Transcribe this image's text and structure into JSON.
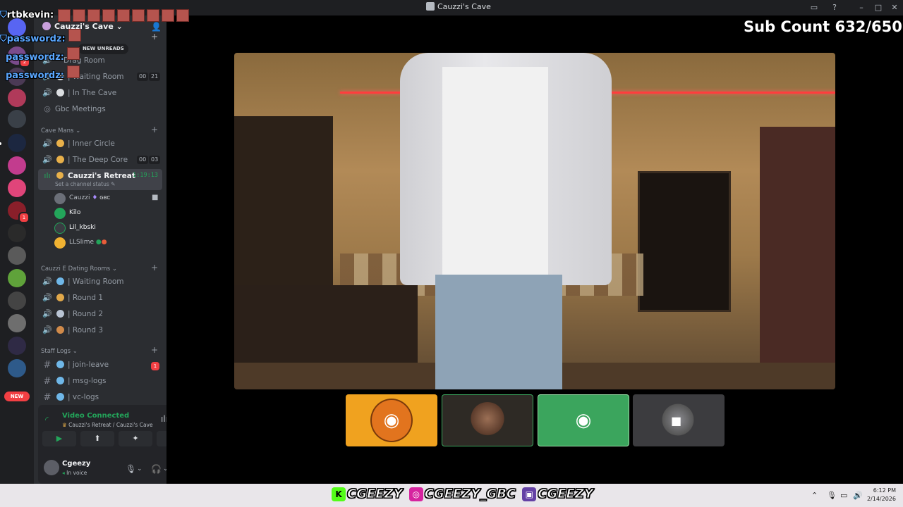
{
  "window": {
    "title": "Cauzzi's Cave"
  },
  "stream_overlay": {
    "sub_count": "Sub Count 632/650",
    "chat": [
      {
        "user": "rtbkevin:"
      },
      {
        "user": "passwordz:"
      },
      {
        "user": "passwordz:"
      },
      {
        "user": "passwordz:"
      }
    ],
    "socials": [
      {
        "icon": "kick-icon",
        "handle": "CGEEZY"
      },
      {
        "icon": "instagram-icon",
        "handle": "CGEEZY_GBC"
      },
      {
        "icon": "twitch-icon",
        "handle": "CGEEZY"
      }
    ]
  },
  "server": {
    "name": "Cauzzi's Cave",
    "new_unreads": "NEW UNREADS",
    "rail_new_label": "NEW",
    "rail_badges": [
      "2",
      "1"
    ]
  },
  "channels": {
    "top": [
      {
        "label": "Drag Room",
        "icon": "speaker-icon"
      },
      {
        "label": "| Waiting Room",
        "icon": "speaker-icon",
        "counts": [
          "00",
          "21"
        ]
      },
      {
        "label": "| In The Cave",
        "icon": "speaker-icon"
      },
      {
        "label": "Gbc Meetings",
        "icon": "stage-icon"
      }
    ],
    "cave_mans": {
      "category": "Cave Mans",
      "items": [
        {
          "label": "| Inner Circle"
        },
        {
          "label": "| The Deep Core",
          "counts": [
            "00",
            "03"
          ]
        },
        {
          "label": "Cauzzi's Retreat",
          "timer": "1:19:13",
          "status": "Set a channel status"
        }
      ],
      "voice_users": [
        {
          "name": "Cauzzi",
          "tag": "GBC",
          "color": "#b5bac1",
          "avatar": "#6b6f78"
        },
        {
          "name": "Kilo",
          "color": "#f2f3f5",
          "avatar": "#23a55a"
        },
        {
          "name": "Lil_kbski",
          "color": "#f2f3f5",
          "avatar": "#3a3c42"
        },
        {
          "name": "LLSlime",
          "color": "#b5bac1",
          "avatar": "#f0b232"
        }
      ]
    },
    "dating": {
      "category": "Cauzzi E Dating Rooms",
      "items": [
        {
          "label": "| Waiting Room"
        },
        {
          "label": "| Round 1"
        },
        {
          "label": "| Round 2"
        },
        {
          "label": "| Round 3"
        }
      ]
    },
    "staff": {
      "category": "Staff Logs",
      "items": [
        {
          "label": "| join-leave",
          "badge": "1"
        },
        {
          "label": "| msg-logs"
        },
        {
          "label": "| vc-logs"
        }
      ]
    }
  },
  "voice_connection": {
    "status": "Video Connected",
    "location": "Cauzzi's Retreat / Cauzzi's Cave"
  },
  "user": {
    "name": "Cgeezy",
    "status": "In voice"
  },
  "clock": {
    "time": "6:12 PM",
    "date": "2/14/2026"
  },
  "colors": {
    "accent_green": "#23a55a",
    "danger_red": "#f23f43",
    "sidebar_bg": "#2b2d31",
    "rail_bg": "#1e1f22"
  }
}
